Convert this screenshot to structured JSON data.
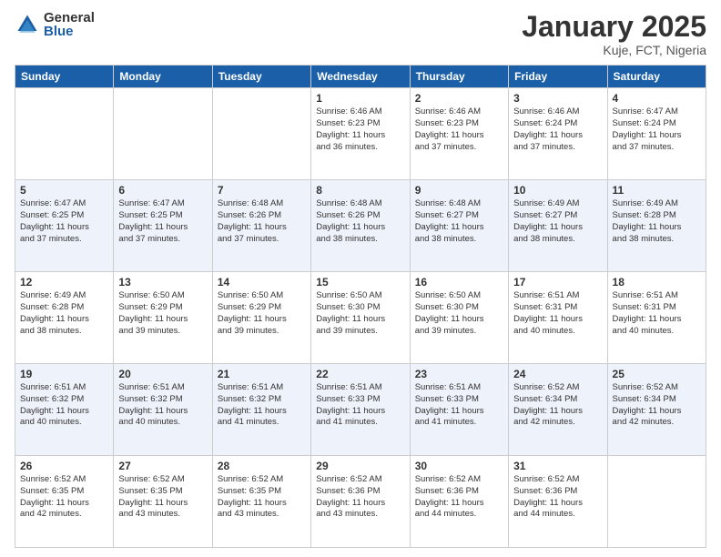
{
  "logo": {
    "general": "General",
    "blue": "Blue"
  },
  "title": "January 2025",
  "location": "Kuje, FCT, Nigeria",
  "days_of_week": [
    "Sunday",
    "Monday",
    "Tuesday",
    "Wednesday",
    "Thursday",
    "Friday",
    "Saturday"
  ],
  "weeks": [
    [
      {
        "day": "",
        "info": ""
      },
      {
        "day": "",
        "info": ""
      },
      {
        "day": "",
        "info": ""
      },
      {
        "day": "1",
        "info": "Sunrise: 6:46 AM\nSunset: 6:23 PM\nDaylight: 11 hours\nand 36 minutes."
      },
      {
        "day": "2",
        "info": "Sunrise: 6:46 AM\nSunset: 6:23 PM\nDaylight: 11 hours\nand 37 minutes."
      },
      {
        "day": "3",
        "info": "Sunrise: 6:46 AM\nSunset: 6:24 PM\nDaylight: 11 hours\nand 37 minutes."
      },
      {
        "day": "4",
        "info": "Sunrise: 6:47 AM\nSunset: 6:24 PM\nDaylight: 11 hours\nand 37 minutes."
      }
    ],
    [
      {
        "day": "5",
        "info": "Sunrise: 6:47 AM\nSunset: 6:25 PM\nDaylight: 11 hours\nand 37 minutes."
      },
      {
        "day": "6",
        "info": "Sunrise: 6:47 AM\nSunset: 6:25 PM\nDaylight: 11 hours\nand 37 minutes."
      },
      {
        "day": "7",
        "info": "Sunrise: 6:48 AM\nSunset: 6:26 PM\nDaylight: 11 hours\nand 37 minutes."
      },
      {
        "day": "8",
        "info": "Sunrise: 6:48 AM\nSunset: 6:26 PM\nDaylight: 11 hours\nand 38 minutes."
      },
      {
        "day": "9",
        "info": "Sunrise: 6:48 AM\nSunset: 6:27 PM\nDaylight: 11 hours\nand 38 minutes."
      },
      {
        "day": "10",
        "info": "Sunrise: 6:49 AM\nSunset: 6:27 PM\nDaylight: 11 hours\nand 38 minutes."
      },
      {
        "day": "11",
        "info": "Sunrise: 6:49 AM\nSunset: 6:28 PM\nDaylight: 11 hours\nand 38 minutes."
      }
    ],
    [
      {
        "day": "12",
        "info": "Sunrise: 6:49 AM\nSunset: 6:28 PM\nDaylight: 11 hours\nand 38 minutes."
      },
      {
        "day": "13",
        "info": "Sunrise: 6:50 AM\nSunset: 6:29 PM\nDaylight: 11 hours\nand 39 minutes."
      },
      {
        "day": "14",
        "info": "Sunrise: 6:50 AM\nSunset: 6:29 PM\nDaylight: 11 hours\nand 39 minutes."
      },
      {
        "day": "15",
        "info": "Sunrise: 6:50 AM\nSunset: 6:30 PM\nDaylight: 11 hours\nand 39 minutes."
      },
      {
        "day": "16",
        "info": "Sunrise: 6:50 AM\nSunset: 6:30 PM\nDaylight: 11 hours\nand 39 minutes."
      },
      {
        "day": "17",
        "info": "Sunrise: 6:51 AM\nSunset: 6:31 PM\nDaylight: 11 hours\nand 40 minutes."
      },
      {
        "day": "18",
        "info": "Sunrise: 6:51 AM\nSunset: 6:31 PM\nDaylight: 11 hours\nand 40 minutes."
      }
    ],
    [
      {
        "day": "19",
        "info": "Sunrise: 6:51 AM\nSunset: 6:32 PM\nDaylight: 11 hours\nand 40 minutes."
      },
      {
        "day": "20",
        "info": "Sunrise: 6:51 AM\nSunset: 6:32 PM\nDaylight: 11 hours\nand 40 minutes."
      },
      {
        "day": "21",
        "info": "Sunrise: 6:51 AM\nSunset: 6:32 PM\nDaylight: 11 hours\nand 41 minutes."
      },
      {
        "day": "22",
        "info": "Sunrise: 6:51 AM\nSunset: 6:33 PM\nDaylight: 11 hours\nand 41 minutes."
      },
      {
        "day": "23",
        "info": "Sunrise: 6:51 AM\nSunset: 6:33 PM\nDaylight: 11 hours\nand 41 minutes."
      },
      {
        "day": "24",
        "info": "Sunrise: 6:52 AM\nSunset: 6:34 PM\nDaylight: 11 hours\nand 42 minutes."
      },
      {
        "day": "25",
        "info": "Sunrise: 6:52 AM\nSunset: 6:34 PM\nDaylight: 11 hours\nand 42 minutes."
      }
    ],
    [
      {
        "day": "26",
        "info": "Sunrise: 6:52 AM\nSunset: 6:35 PM\nDaylight: 11 hours\nand 42 minutes."
      },
      {
        "day": "27",
        "info": "Sunrise: 6:52 AM\nSunset: 6:35 PM\nDaylight: 11 hours\nand 43 minutes."
      },
      {
        "day": "28",
        "info": "Sunrise: 6:52 AM\nSunset: 6:35 PM\nDaylight: 11 hours\nand 43 minutes."
      },
      {
        "day": "29",
        "info": "Sunrise: 6:52 AM\nSunset: 6:36 PM\nDaylight: 11 hours\nand 43 minutes."
      },
      {
        "day": "30",
        "info": "Sunrise: 6:52 AM\nSunset: 6:36 PM\nDaylight: 11 hours\nand 44 minutes."
      },
      {
        "day": "31",
        "info": "Sunrise: 6:52 AM\nSunset: 6:36 PM\nDaylight: 11 hours\nand 44 minutes."
      },
      {
        "day": "",
        "info": ""
      }
    ]
  ]
}
